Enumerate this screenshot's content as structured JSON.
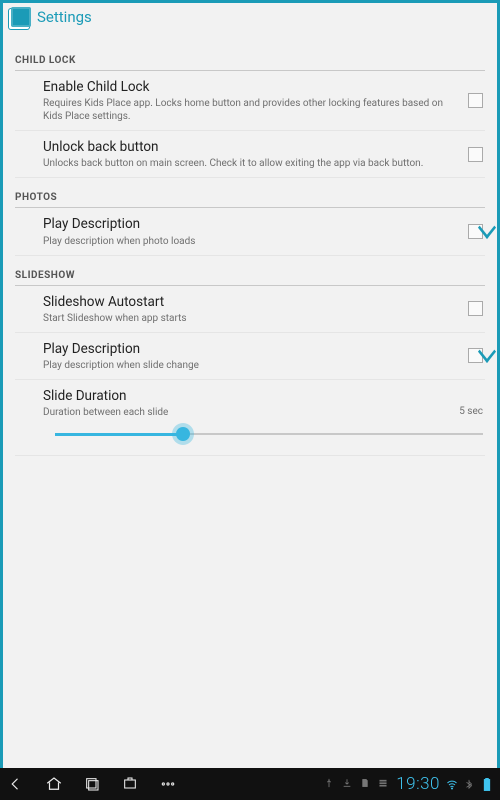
{
  "action_bar": {
    "title": "Settings"
  },
  "sections": {
    "child_lock": {
      "header": "CHILD LOCK",
      "enable": {
        "title": "Enable Child Lock",
        "summary": "Requires Kids Place app. Locks home button and provides other locking features based on Kids Place settings.",
        "checked": false
      },
      "unlock_back": {
        "title": "Unlock back button",
        "summary": "Unlocks back button on main screen. Check it to allow exiting the app via back button.",
        "checked": false
      }
    },
    "photos": {
      "header": "PHOTOS",
      "play_desc": {
        "title": "Play Description",
        "summary": "Play description when photo loads",
        "checked": true
      }
    },
    "slideshow": {
      "header": "SLIDESHOW",
      "autostart": {
        "title": "Slideshow Autostart",
        "summary": "Start Slideshow when app starts",
        "checked": false
      },
      "play_desc": {
        "title": "Play Description",
        "summary": "Play description when slide change",
        "checked": true
      },
      "duration": {
        "title": "Slide Duration",
        "summary": "Duration between each slide",
        "value_label": "5 sec",
        "slider_percent": 30
      }
    }
  },
  "status_bar": {
    "time": "19:30"
  }
}
